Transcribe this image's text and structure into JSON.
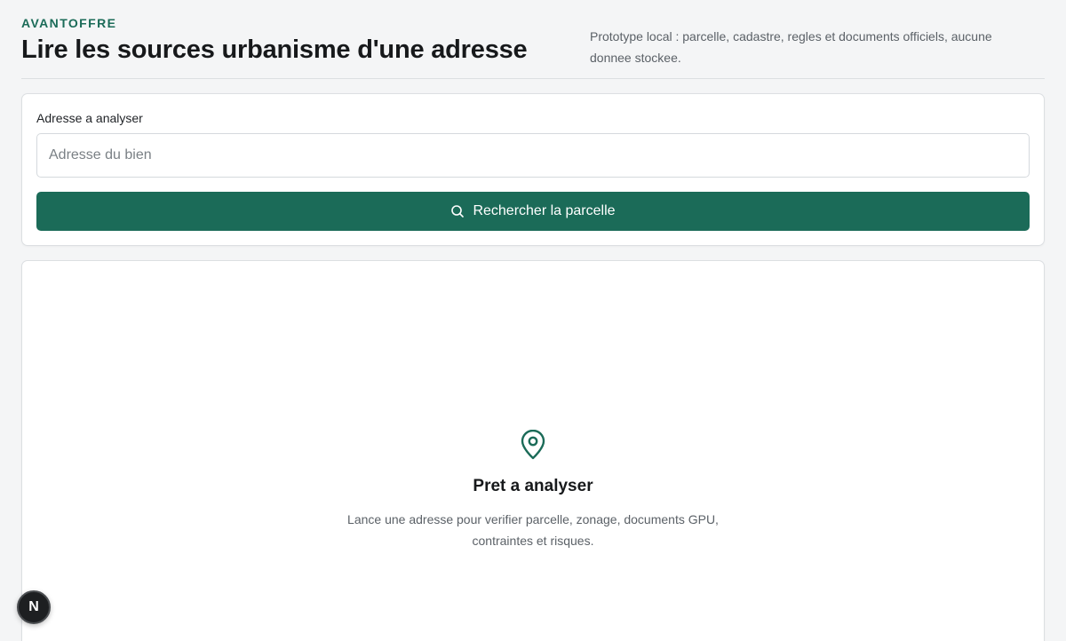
{
  "header": {
    "brand": "AVANTOFFRE",
    "title": "Lire les sources urbanisme d'une adresse",
    "subtitle": "Prototype local : parcelle, cadastre, regles et documents officiels, aucune donnee stockee."
  },
  "search": {
    "label": "Adresse a analyser",
    "placeholder": "Adresse du bien",
    "value": "",
    "button_label": "Rechercher la parcelle",
    "button_icon": "search-icon"
  },
  "empty_state": {
    "icon": "map-pin-icon",
    "title": "Pret a analyser",
    "description": "Lance une adresse pour verifier parcelle, zonage, documents GPU, contraintes et risques."
  },
  "dev_badge": {
    "label": "N"
  },
  "colors": {
    "accent": "#1b6b58",
    "background": "#f4f5f6",
    "card": "#ffffff",
    "border": "#dcdfe2",
    "muted_text": "#5b6167"
  }
}
